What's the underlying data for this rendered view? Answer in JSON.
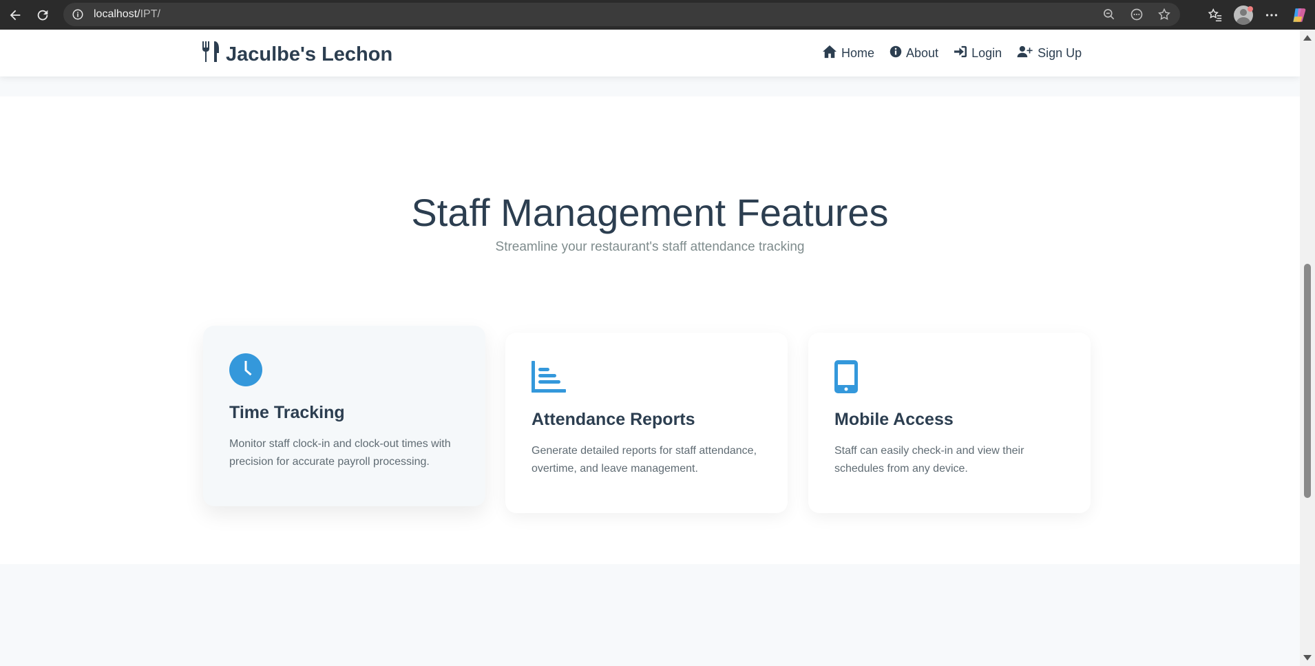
{
  "browser": {
    "url_host": "localhost/",
    "url_path": "IPT/"
  },
  "header": {
    "brand": "Jaculbe's Lechon",
    "nav": {
      "home": "Home",
      "about": "About",
      "login": "Login",
      "signup": "Sign Up"
    }
  },
  "features": {
    "title": "Staff Management Features",
    "subtitle": "Streamline your restaurant's staff attendance tracking",
    "cards": [
      {
        "icon": "clock-icon",
        "title": "Time Tracking",
        "text": "Monitor staff clock-in and clock-out times with precision for accurate payroll processing."
      },
      {
        "icon": "chart-icon",
        "title": "Attendance Reports",
        "text": "Generate detailed reports for staff attendance, overtime, and leave management."
      },
      {
        "icon": "mobile-icon",
        "title": "Mobile Access",
        "text": "Staff can easily check-in and view their schedules from any device."
      }
    ]
  },
  "colors": {
    "accent": "#3498db",
    "text": "#2c3e50"
  }
}
